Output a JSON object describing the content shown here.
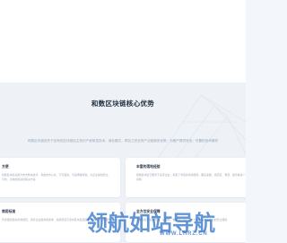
{
  "section": {
    "title": "和数区块链核心优势",
    "subtitle": "和数区块链依托于自有的区块链自主知识产权研发技术、商业模式，再加之完全的产业链服务优势，为客户提供安全、可靠的技术服务",
    "cards": [
      {
        "title": "方便",
        "desc": "和数区块链采用分布式账本技术，具备去中心化、不可篡改、可追溯等特性，为企业提供安全、可信、高效的区块链解决方案"
      },
      {
        "title": "丰富的落地经验",
        "desc": "和数区块链已服务于多家企业，积累了丰富的落地经验，覆盖金融、供应链、溯源、政务等多个领域"
      },
      {
        "title": "商用标准",
        "desc": "符合国家相关标准规范，满足企业级商用需求，提供稳定可靠的区块链底层平台与技术支持服务"
      },
      {
        "title": "全方位安全保障",
        "desc": "多重加密与权限管理，从网络、数据到应用层面，为企业提供全方位的安全保障"
      }
    ]
  },
  "watermark": {
    "text": "领航如站导航",
    "url": "WWW.LHRZ.CN"
  },
  "colors": {
    "accent": "#2f7fd6",
    "watermark": "#266cc4",
    "background": "#eef2f7"
  }
}
